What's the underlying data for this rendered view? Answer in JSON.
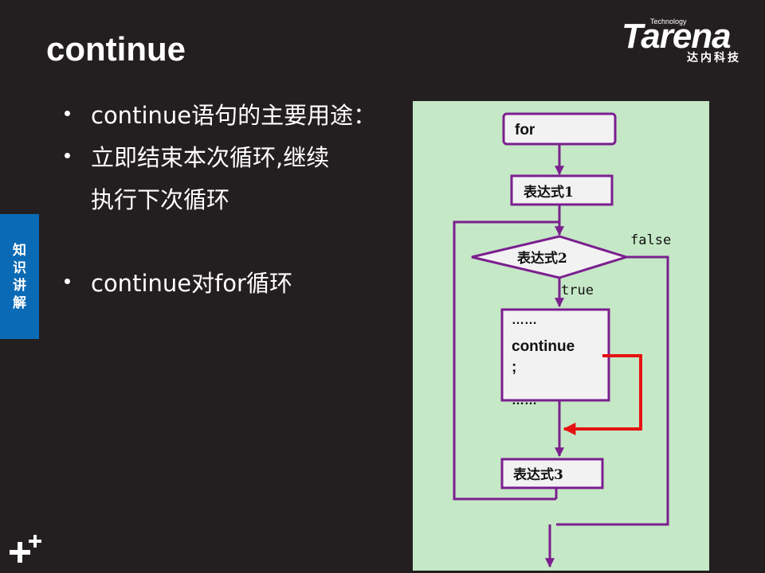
{
  "slide": {
    "title": "continue",
    "side_tab": [
      "知",
      "识",
      "讲",
      "解"
    ],
    "logo": {
      "small": "Technology",
      "big": "Tarena",
      "cn": "达内科技"
    },
    "bullets": [
      "continue语句的主要用途：",
      "立即结束本次循环,继续",
      "执行下次循环",
      "continue对for循环"
    ]
  },
  "flowchart": {
    "for_label": "for",
    "expr1": "表达式1",
    "expr2": "表达式2",
    "expr3": "表达式3",
    "false_label": "false",
    "true_label": "true",
    "body_line1": "……",
    "body_line2": "continue",
    "body_line3": ";",
    "body_line4": "……"
  },
  "colors": {
    "purple": "#7b1f8f",
    "red": "#e61212",
    "panel": "#c5e8c6",
    "tab": "#0a6ab5",
    "bg": "#231f20"
  }
}
